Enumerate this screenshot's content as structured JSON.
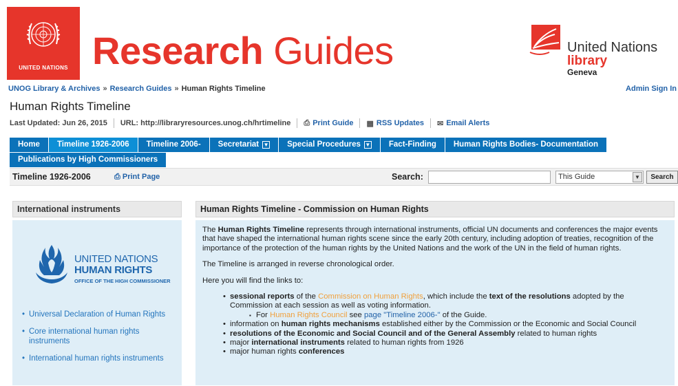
{
  "banner": {
    "un_logo_text": "UNITED NATIONS",
    "title_bold": "Research",
    "title_rest": "Guides",
    "library_line1": "United Nations",
    "library_line2": "library",
    "library_line3": "Geneva"
  },
  "breadcrumb": {
    "items": [
      "UNOG Library & Archives",
      "Research Guides",
      "Human Rights Timeline"
    ],
    "separator": "»"
  },
  "admin_link": "Admin Sign In",
  "page_title": "Human Rights Timeline",
  "meta": {
    "last_updated": "Last Updated: Jun 26, 2015",
    "url_label": "URL:",
    "url_value": "http://libraryresources.unog.ch/hrtimeline",
    "print_guide": "Print Guide",
    "rss_updates": "RSS Updates",
    "email_alerts": "Email Alerts"
  },
  "tabs": {
    "row1": [
      {
        "label": "Home",
        "dropdown": false,
        "active": false
      },
      {
        "label": "Timeline 1926-2006",
        "dropdown": false,
        "active": true
      },
      {
        "label": "Timeline 2006-",
        "dropdown": false,
        "active": false
      },
      {
        "label": "Secretariat",
        "dropdown": true,
        "active": false
      },
      {
        "label": "Special Procedures",
        "dropdown": true,
        "active": false
      },
      {
        "label": "Fact-Finding",
        "dropdown": false,
        "active": false
      },
      {
        "label": "Human Rights Bodies- Documentation",
        "dropdown": false,
        "active": false
      }
    ],
    "row2": [
      {
        "label": "Publications by High Commissioners",
        "dropdown": false,
        "active": false
      }
    ]
  },
  "subbar": {
    "section_title": "Timeline 1926-2006",
    "print_page": "Print Page",
    "search_label": "Search:",
    "search_value": "",
    "scope_selected": "This Guide",
    "search_button": "Search"
  },
  "left_box": {
    "header": "International instruments",
    "ohchr_line1": "UNITED NATIONS",
    "ohchr_line2": "HUMAN RIGHTS",
    "ohchr_line3": "OFFICE OF THE HIGH COMMISSIONER",
    "links": [
      "Universal Declaration of Human Rights",
      "Core international human rights instruments",
      "International human rights instruments"
    ]
  },
  "main_box": {
    "header": "Human Rights Timeline - Commission on Human Rights",
    "intro_the": "The",
    "intro_bold": "Human Rights Timeline",
    "intro_rest": "represents through international instruments, official UN documents and conferences the major events that have shaped the international human rights scene since the early 20th century, including adoption of treaties, recognition of the importance of the protection of the human rights by the United Nations and the work of the UN in the field of human rights.",
    "order_text": "The Timeline is arranged in reverse chronological order.",
    "links_intro": "Here you will find the links to:",
    "b1_bold": "sessional reports",
    "b1_of": "of the",
    "b1_link": "Commission on Human Rights",
    "b1_mid": ", which include the",
    "b1_bold2": "text of the resolutions",
    "b1_rest": "adopted by the Commission at each session as well as voting information.",
    "sub_for": "For",
    "sub_link1": "Human Rights Council",
    "sub_see": "see",
    "sub_link2": "page \"Timeline 2006-\"",
    "sub_rest": "of the Guide.",
    "b2_pre": "information on",
    "b2_bold": "human rights mechanisms",
    "b2_rest": "established either by the Commission or the Economic and Social Council",
    "b3_bold": "resolutions of the Economic and Social Council and of the General Assembly",
    "b3_rest": "related to human rights",
    "b4_pre": "major",
    "b4_bold": "international instruments",
    "b4_rest": "related to human rights from 1926",
    "b5_pre": "major human rights",
    "b5_bold": "conferences"
  },
  "colors": {
    "brand_red": "#e6352b",
    "tab_blue": "#0b72b9",
    "tab_active": "#0e8fd6",
    "link_blue": "#2262a8",
    "orange_link": "#f0a03c",
    "panel_bg": "#dfeef7"
  }
}
